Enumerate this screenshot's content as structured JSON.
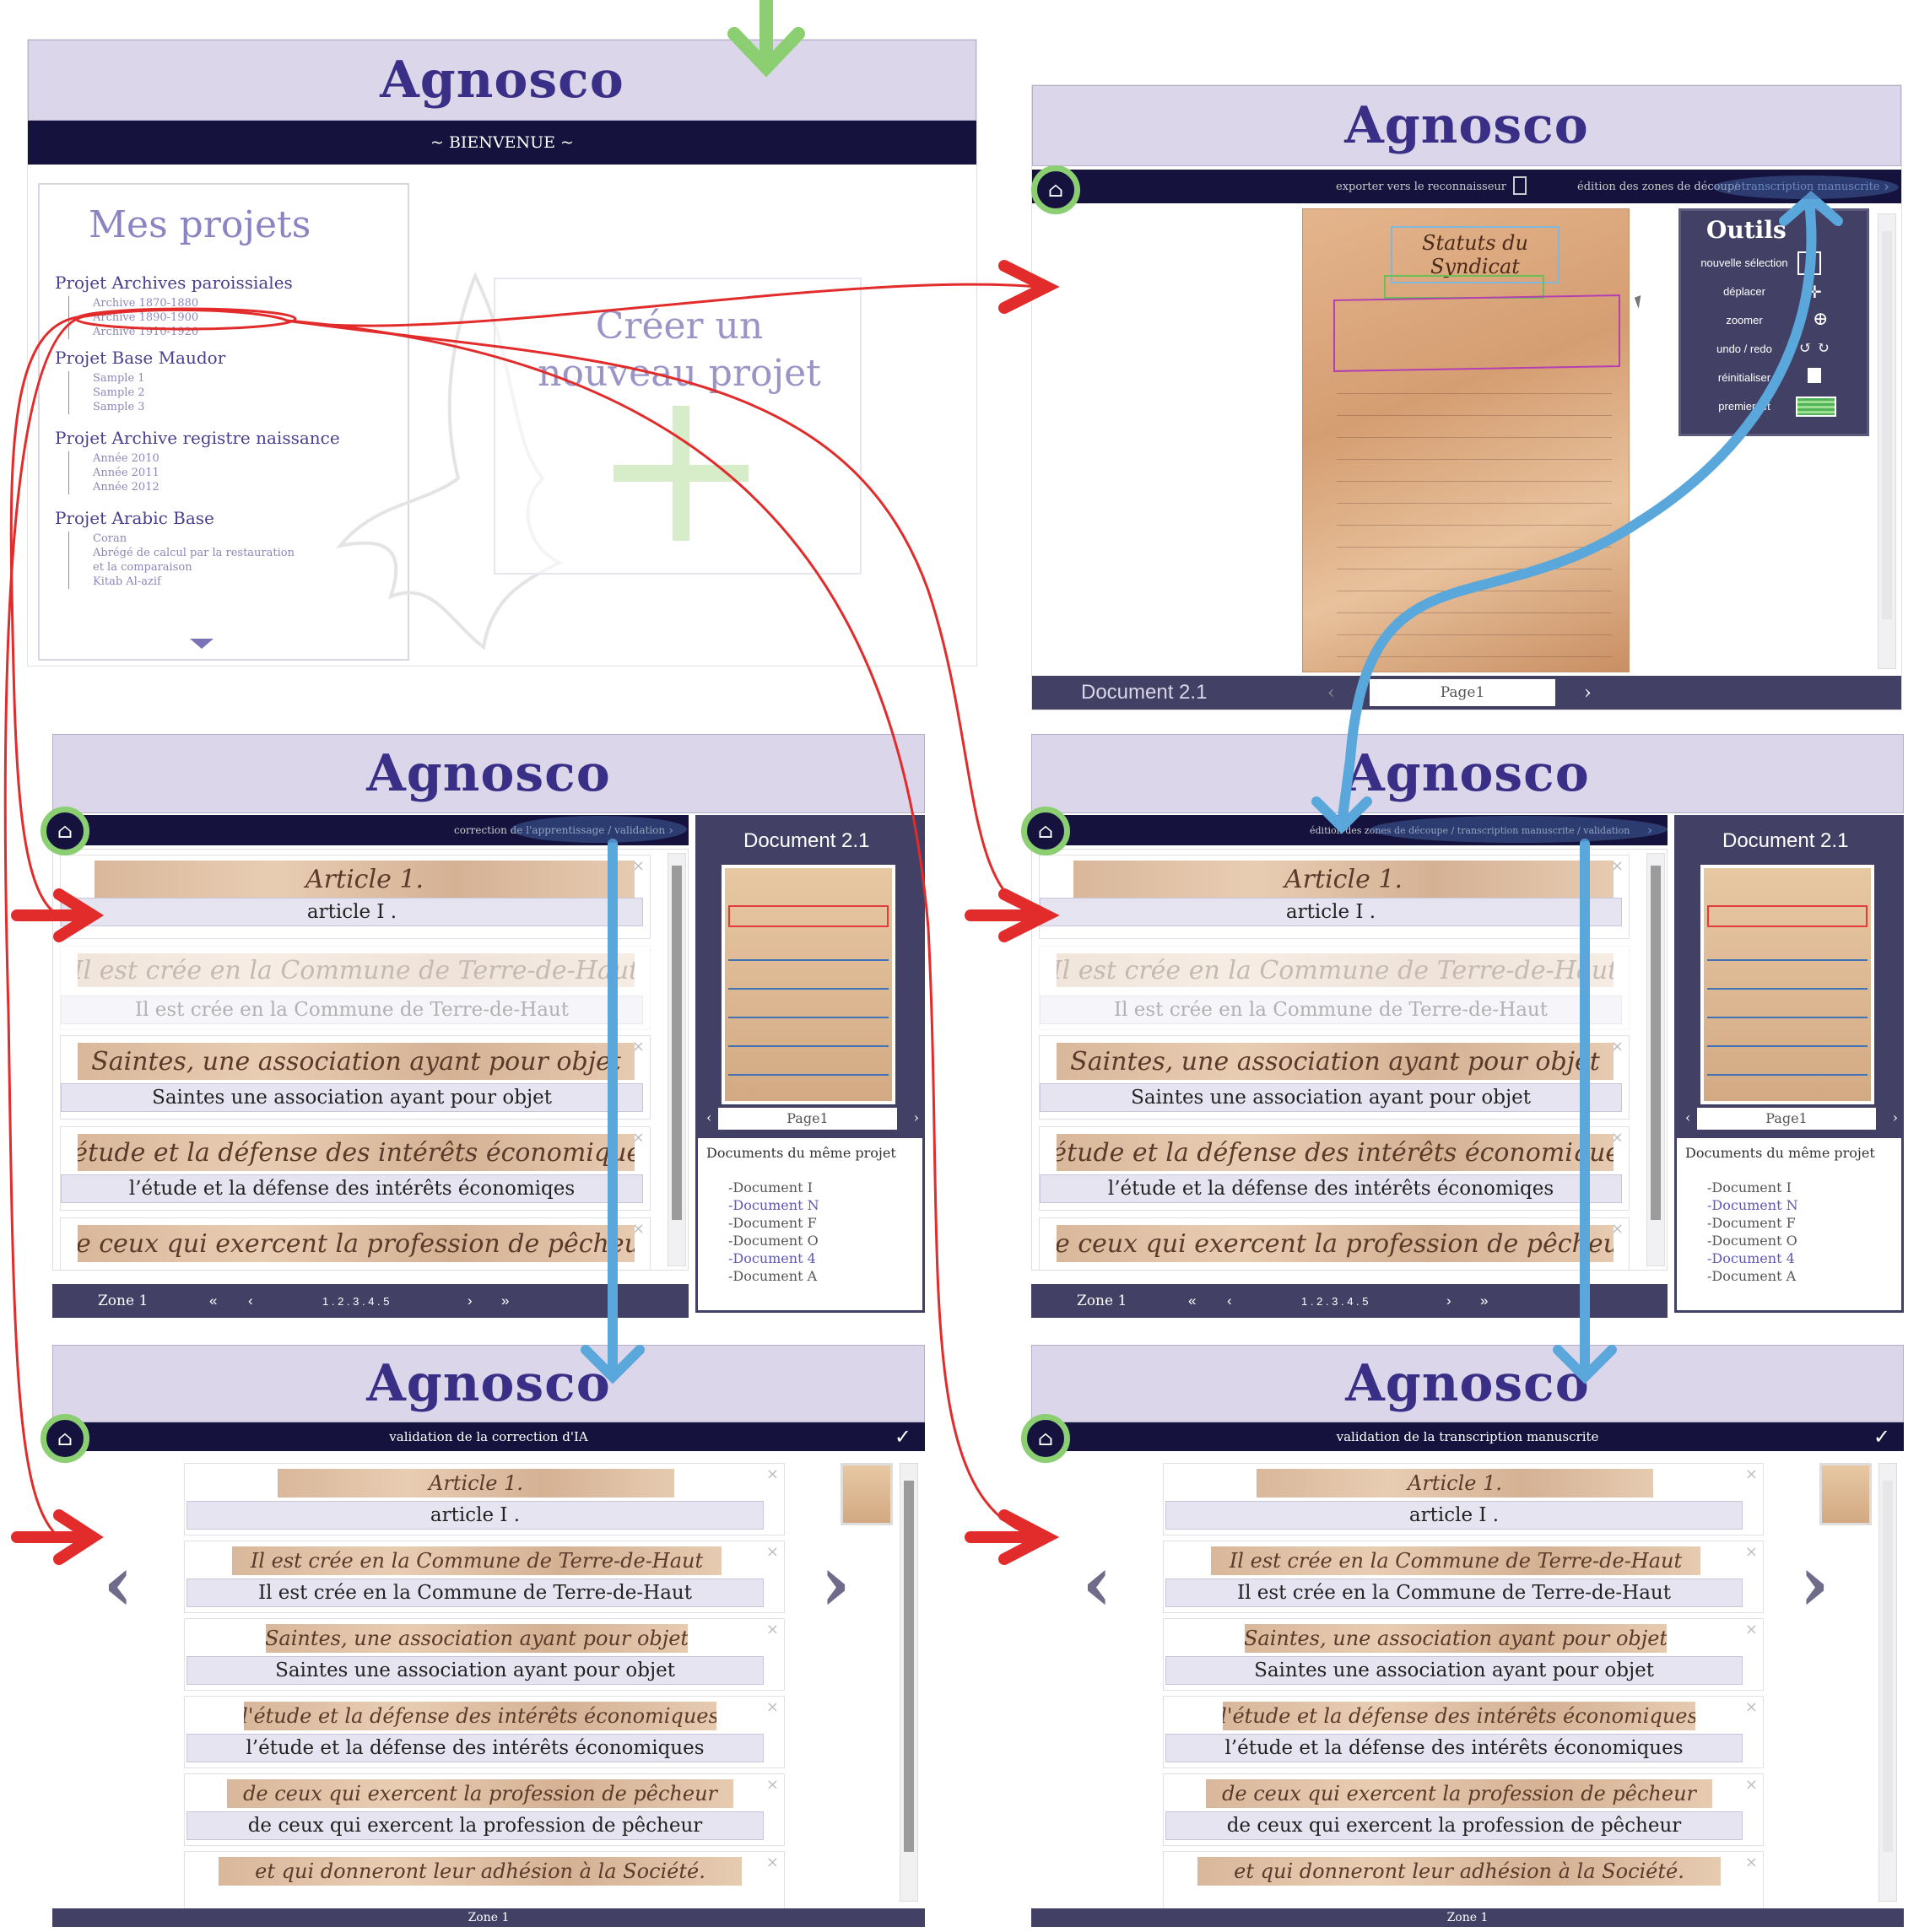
{
  "app": {
    "logo": "Agnosco"
  },
  "welcome": {
    "banner": "~ BIENVENUE ~",
    "my_projects_title": "Mes projets",
    "projects": [
      {
        "title": "Projet Archives paroissiales",
        "items": [
          "Archive 1870-1880",
          "Archive 1890-1900",
          "Archive 1910-1920"
        ]
      },
      {
        "title": "Projet Base Maudor",
        "items": [
          "Sample 1",
          "Sample 2",
          "Sample 3"
        ]
      },
      {
        "title": "Projet Archive registre naissance",
        "items": [
          "Année 2010",
          "Année 2011",
          "Année 2012"
        ]
      },
      {
        "title": "Projet Arabic Base",
        "items": [
          "Coran",
          "Abrégé de calcul par la restauration",
          "et la comparaison",
          "Kitab Al-azif"
        ]
      }
    ],
    "new_project": "Créer un nouveau projet"
  },
  "editor": {
    "export_label": "exporter vers le reconnaisseur",
    "nav_crumb_a": "édition des zones de découpe",
    "nav_crumb_b": " / transcription manuscrite",
    "tools_title": "Outils",
    "tools": [
      "nouvelle sélection",
      "déplacer",
      "zoomer",
      "undo / redo",
      "réinitialiser",
      "premier jet"
    ],
    "doc_title": "Statuts du Syndicat",
    "doc_name": "Document 2.1",
    "page_label": "Page1"
  },
  "correction": {
    "crumb": "correction de l'apprentissage / validation",
    "crumb2": "édition des zones de découpe / transcription manuscrite / validation",
    "lines": [
      {
        "scan": "Article 1.",
        "text": "article I ."
      },
      {
        "scan": "Il est crée en la Commune de Terre-de-Haut",
        "text": "Il est crée en la Commune de Terre-de-Haut"
      },
      {
        "scan": "Saintes, une association ayant pour objet",
        "text": "Saintes une association ayant pour objet"
      },
      {
        "scan": "l'étude et la défense des intérêts économiques",
        "text": "l’étude et la défense des intérêts économiqes"
      },
      {
        "scan": "de ceux qui exercent la profession de pêcheur",
        "text": ""
      }
    ],
    "zone_label": "Zone 1",
    "pages": "1 . 2 . 3 . 4 . 5",
    "doc_name": "Document 2.1",
    "page_label": "Page1",
    "same_project_title": "Documents du même projet",
    "same_project_docs": [
      "-Document I",
      "-Document N",
      "-Document F",
      "-Document O",
      "-Document 4",
      "-Document A"
    ]
  },
  "validation_ai": {
    "title": "validation de la correction d'IA",
    "check": "✓",
    "lines": [
      {
        "scan": "Article 1.",
        "text": "article I ."
      },
      {
        "scan": "Il est crée en la Commune de Terre-de-Haut",
        "text": "Il est crée en la Commune de Terre-de-Haut"
      },
      {
        "scan": "Saintes, une association ayant pour objet",
        "text": "Saintes une association ayant pour objet"
      },
      {
        "scan": "l'étude et la défense des intérêts économiques",
        "text": "l’étude et la défense des intérêts économiques"
      },
      {
        "scan": "de ceux qui exercent la profession de pêcheur",
        "text": "de ceux qui exercent la profession de pêcheur"
      },
      {
        "scan": "et qui donneront leur adhésion à la Société.",
        "text": ""
      }
    ],
    "zone_label": "Zone 1"
  },
  "validation_hw": {
    "title": "validation de la transcription manuscrite",
    "check": "✓",
    "zone_label": "Zone 1"
  },
  "colors": {
    "header_bg": "#dcd6ea",
    "navbar": "#15133d",
    "accent": "#3a2f86",
    "panel": "#434066",
    "flow_red": "#e22b2b",
    "flow_blue": "#5aa7dc",
    "highlight_green": "#8ccf73"
  }
}
